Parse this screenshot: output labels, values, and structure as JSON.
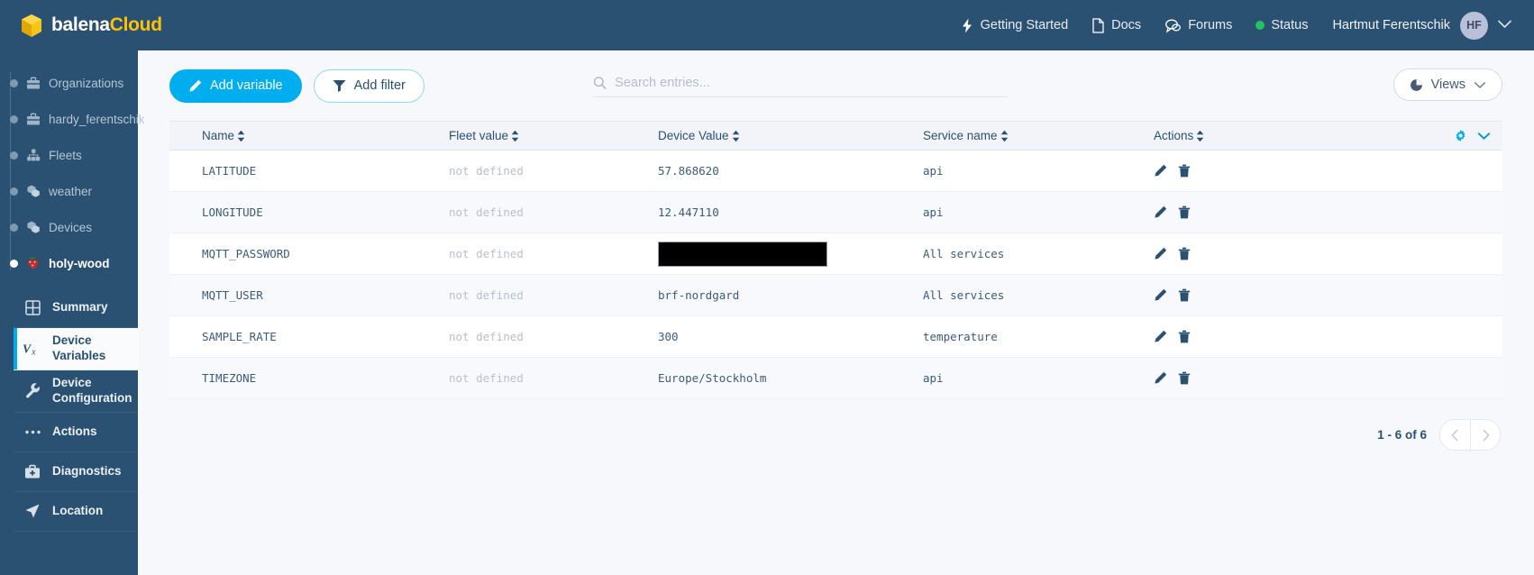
{
  "brand": {
    "name_primary": "balena",
    "name_secondary": "Cloud",
    "cube_color": "#f5c518",
    "accent": "#00aeef",
    "header_bg": "#2a5072"
  },
  "topnav": {
    "items": [
      {
        "label": "Getting Started",
        "icon": "lightning-icon"
      },
      {
        "label": "Docs",
        "icon": "document-icon"
      },
      {
        "label": "Forums",
        "icon": "chat-icon"
      },
      {
        "label": "Status",
        "icon": "status-dot-icon",
        "dot_color": "#22c55e"
      }
    ],
    "user": {
      "name": "Hartmut Ferentschik",
      "initials": "HF"
    }
  },
  "sidebar": {
    "breadcrumbs": [
      {
        "label": "Organizations",
        "icon": "briefcase-icon",
        "active": false
      },
      {
        "label": "hardy_ferentschik",
        "icon": "briefcase-icon",
        "active": false
      },
      {
        "label": "Fleets",
        "icon": "fleet-icon",
        "active": false
      },
      {
        "label": "weather",
        "icon": "devices-icon",
        "active": false
      },
      {
        "label": "Devices",
        "icon": "devices-icon",
        "active": false
      },
      {
        "label": "holy-wood",
        "icon": "raspberry-pi-icon",
        "active": true
      }
    ],
    "submenu": [
      {
        "label": "Summary",
        "icon": "grid-icon",
        "active": false
      },
      {
        "label": "Device Variables",
        "icon": "vx-icon",
        "active": true
      },
      {
        "label": "Device Configuration",
        "icon": "wrench-icon",
        "active": false
      },
      {
        "label": "Actions",
        "icon": "ellipsis-icon",
        "active": false
      },
      {
        "label": "Diagnostics",
        "icon": "medkit-icon",
        "active": false
      },
      {
        "label": "Location",
        "icon": "navigation-icon",
        "active": false
      }
    ]
  },
  "toolbar": {
    "add_variable_label": "Add variable",
    "add_filter_label": "Add filter",
    "views_label": "Views",
    "search_placeholder": "Search entries...",
    "search_value": ""
  },
  "table": {
    "columns": [
      {
        "label": "Name",
        "sortable": true
      },
      {
        "label": "Fleet value",
        "sortable": true
      },
      {
        "label": "Device Value",
        "sortable": true
      },
      {
        "label": "Service name",
        "sortable": true
      },
      {
        "label": "Actions",
        "sortable": true
      }
    ],
    "rows": [
      {
        "name": "LATITUDE",
        "fleet_value": "not defined",
        "device_value": "57.868620",
        "redacted": false,
        "service_name": "api"
      },
      {
        "name": "LONGITUDE",
        "fleet_value": "not defined",
        "device_value": "12.447110",
        "redacted": false,
        "service_name": "api"
      },
      {
        "name": "MQTT_PASSWORD",
        "fleet_value": "not defined",
        "device_value": "",
        "redacted": true,
        "service_name": "All services"
      },
      {
        "name": "MQTT_USER",
        "fleet_value": "not defined",
        "device_value": "brf-nordgard",
        "redacted": false,
        "service_name": "All services"
      },
      {
        "name": "SAMPLE_RATE",
        "fleet_value": "not defined",
        "device_value": "300",
        "redacted": false,
        "service_name": "temperature"
      },
      {
        "name": "TIMEZONE",
        "fleet_value": "not defined",
        "device_value": "Europe/Stockholm",
        "redacted": false,
        "service_name": "api"
      }
    ],
    "row_actions": [
      {
        "icon": "edit-pencil-icon"
      },
      {
        "icon": "delete-trash-icon"
      }
    ]
  },
  "pagination": {
    "label": "1 - 6 of 6"
  }
}
